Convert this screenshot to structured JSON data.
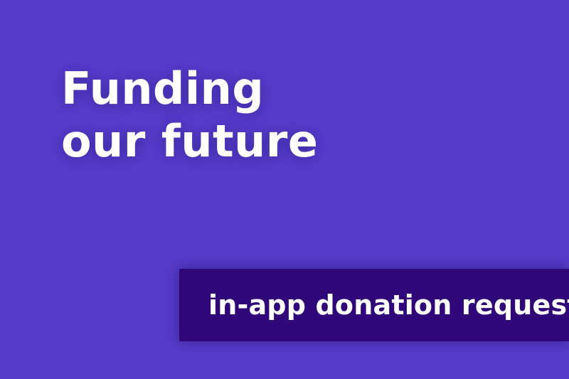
{
  "headline": {
    "line1": "Funding",
    "line2": "our future"
  },
  "tagline": {
    "text": "in-app donation request"
  },
  "colors": {
    "background": "#553BC9",
    "tagline_background": "#2F0778",
    "text": "#FFFFFF"
  }
}
